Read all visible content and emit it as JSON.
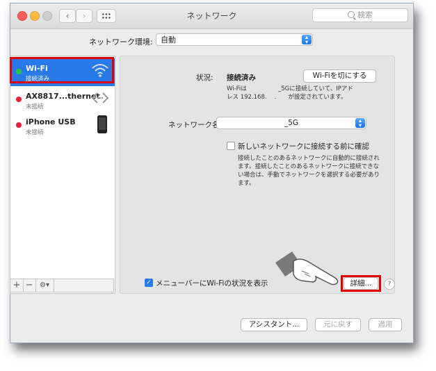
{
  "window": {
    "title": "ネットワーク",
    "search_placeholder": "検索",
    "nav_back": "‹",
    "nav_forward": "›"
  },
  "location": {
    "label": "ネットワーク環境:",
    "value": "自動"
  },
  "sidebar": {
    "items": [
      {
        "name": "Wi-Fi",
        "status": "接続済み",
        "dot_color": "#28c840",
        "icon": "wifi-icon",
        "selected": true
      },
      {
        "name": "AX8817...thernet",
        "status": "未接続",
        "dot_color": "#e8203a",
        "icon": "ethernet-icon",
        "selected": false
      },
      {
        "name": "iPhone USB",
        "status": "未接続",
        "dot_color": "#e8203a",
        "icon": "iphone-icon",
        "selected": false
      }
    ],
    "add_label": "+",
    "remove_label": "−",
    "action_label": "⚙▾"
  },
  "detail": {
    "status_label": "状況:",
    "status_value": "接続済み",
    "wifi_off_button": "Wi-Fiを切にする",
    "status_desc_line1": "Wi-Fiは　　　　　 _5Gに接続していて、IPアド",
    "status_desc_line2": "レス 192.168.　 .　　が設定されています。",
    "network_name_label": "ネットワーク名:",
    "network_name_value": "_5G",
    "ask_checkbox_label": "新しいネットワークに接続する前に確認",
    "ask_desc_line1": "接続したことのあるネットワークに自動的に接続され",
    "ask_desc_line2": "ます。接続したことのあるネットワークに接続できな",
    "ask_desc_line3": "い場合は、手動でネットワークを選択する必要があり",
    "ask_desc_line4": "ます。",
    "menubar_checkbox_label": "メニューバーにWi-Fiの状況を表示",
    "advanced_button": "詳細...",
    "help_label": "?"
  },
  "footer": {
    "assistant_button": "アシスタント...",
    "revert_button": "元に戻す",
    "apply_button": "適用"
  },
  "colors": {
    "selection_blue": "#2a79e8",
    "highlight_red": "#e00000"
  }
}
